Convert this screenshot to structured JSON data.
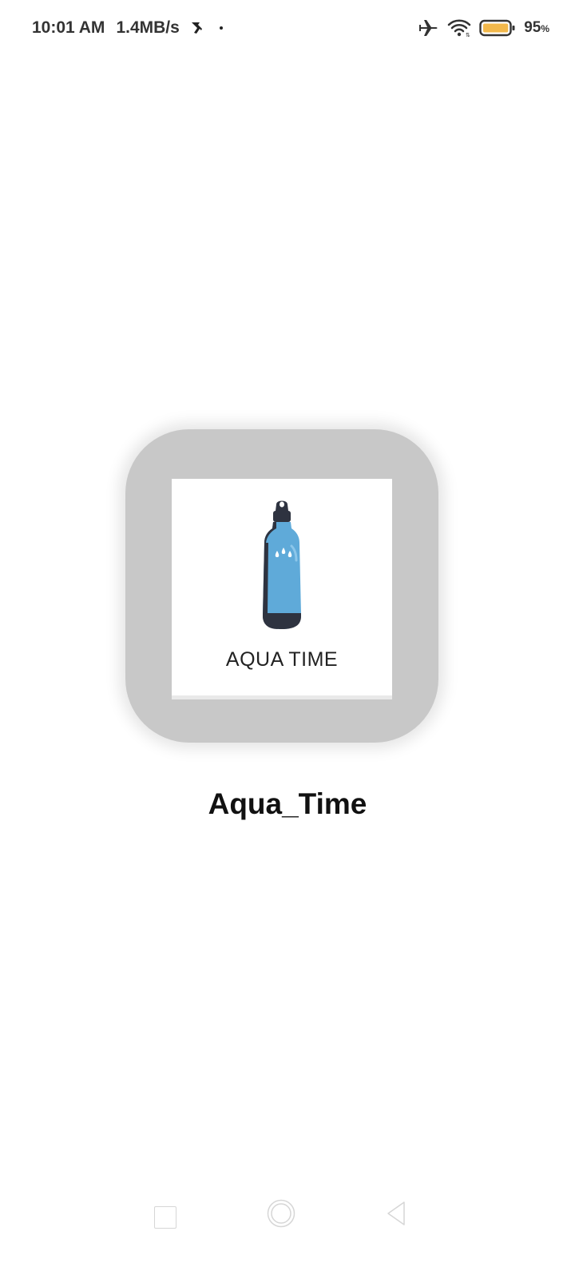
{
  "status_bar": {
    "time": "10:01 AM",
    "network_speed": "1.4MB/s",
    "battery_percent": "95",
    "battery_suffix": "%",
    "battery_level": 0.95,
    "icons": [
      "notification-icon",
      "airplane-mode-icon",
      "wifi-icon",
      "battery-icon"
    ]
  },
  "splash": {
    "logo_text": "AQUA TIME",
    "app_name": "Aqua_Time"
  },
  "colors": {
    "card_background": "#c8c8c8",
    "bottle_body": "#5faad9",
    "bottle_cap": "#2e3340",
    "battery_fill": "#f2b84b"
  },
  "nav_bar": {
    "buttons": [
      "recents-button",
      "home-button",
      "back-button"
    ]
  }
}
